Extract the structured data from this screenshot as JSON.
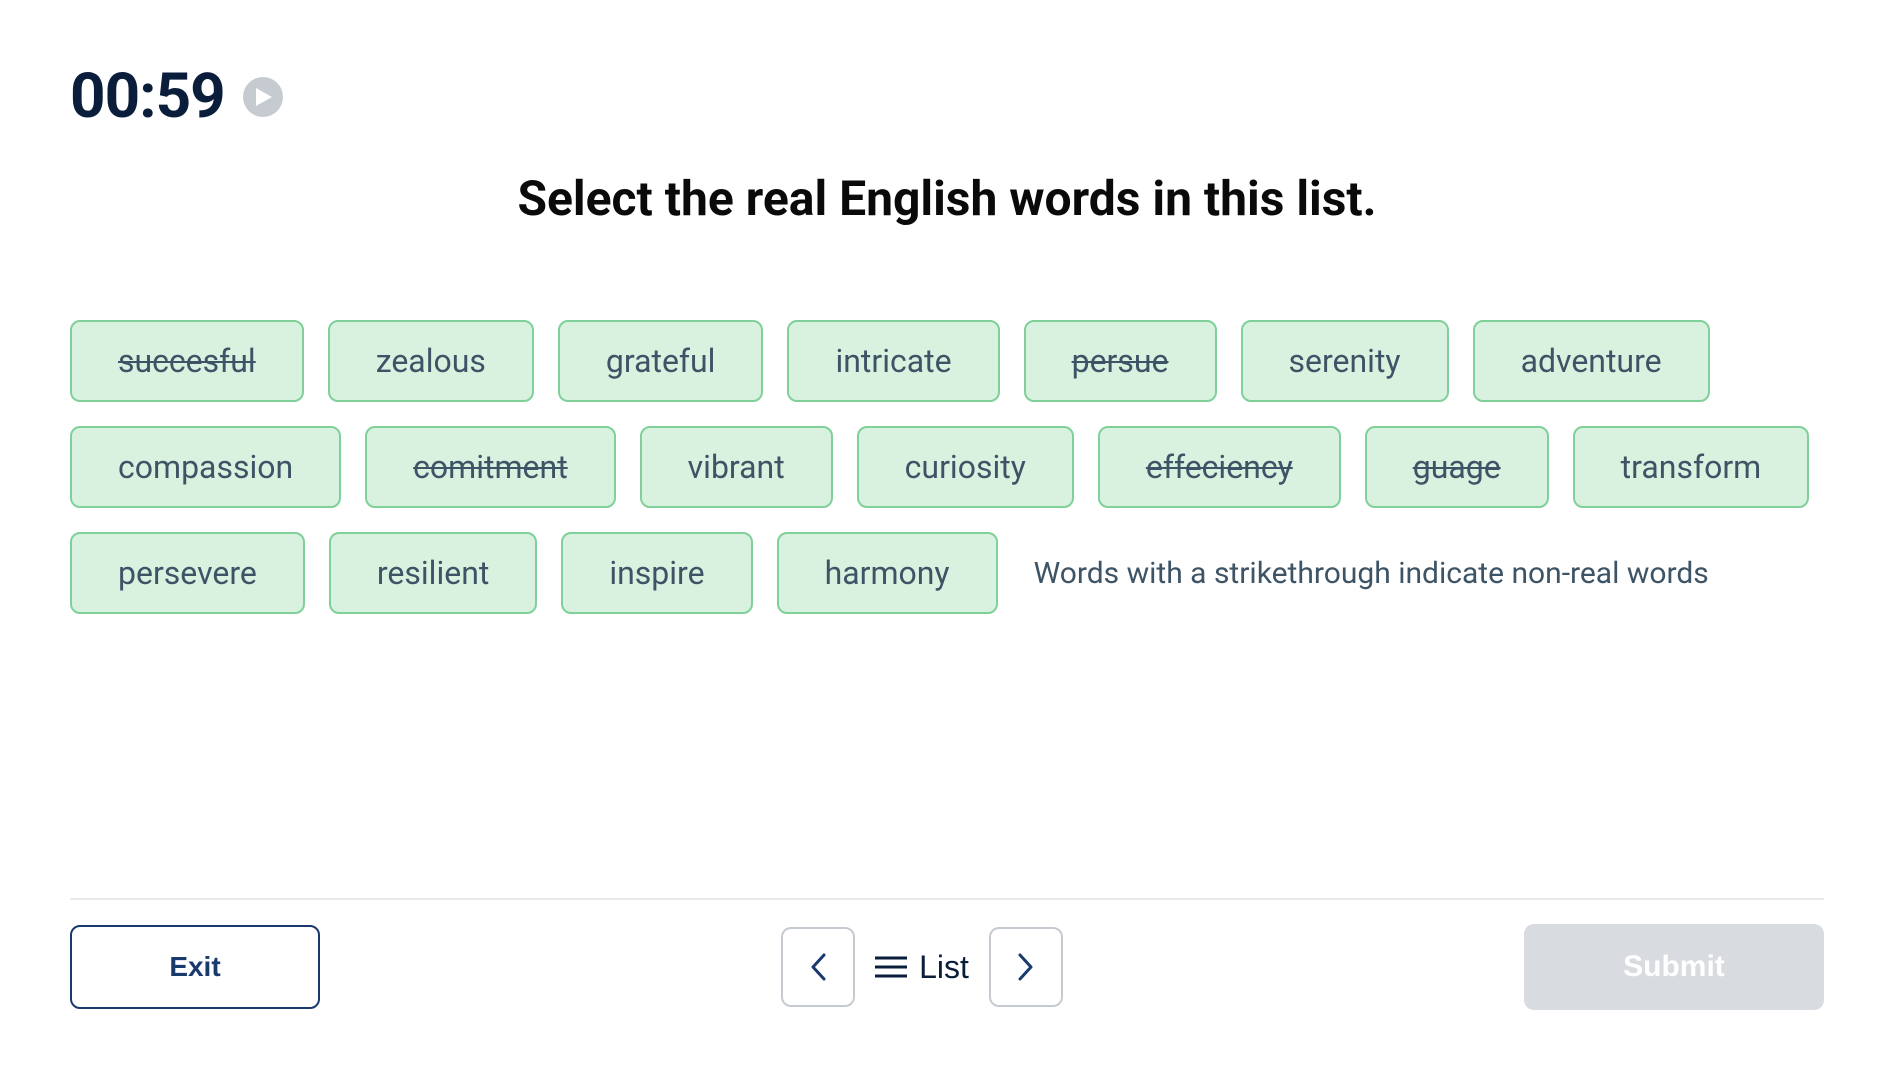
{
  "timer": "00:59",
  "title": "Select the real English words in this list.",
  "words": [
    {
      "text": "succesful",
      "strike": true
    },
    {
      "text": "zealous",
      "strike": false
    },
    {
      "text": "grateful",
      "strike": false
    },
    {
      "text": "intricate",
      "strike": false
    },
    {
      "text": "persue",
      "strike": true
    },
    {
      "text": "serenity",
      "strike": false
    },
    {
      "text": "adventure",
      "strike": false
    },
    {
      "text": "compassion",
      "strike": false
    },
    {
      "text": "comitment",
      "strike": true
    },
    {
      "text": "vibrant",
      "strike": false
    },
    {
      "text": "curiosity",
      "strike": false
    },
    {
      "text": "effeciency",
      "strike": true
    },
    {
      "text": "guage",
      "strike": true
    },
    {
      "text": "transform",
      "strike": false
    },
    {
      "text": "persevere",
      "strike": false
    },
    {
      "text": "resilient",
      "strike": false
    },
    {
      "text": "inspire",
      "strike": false
    },
    {
      "text": "harmony",
      "strike": false
    }
  ],
  "hint": "Words with a strikethrough indicate non-real words",
  "footer": {
    "exit_label": "Exit",
    "list_label": "List",
    "submit_label": "Submit"
  }
}
